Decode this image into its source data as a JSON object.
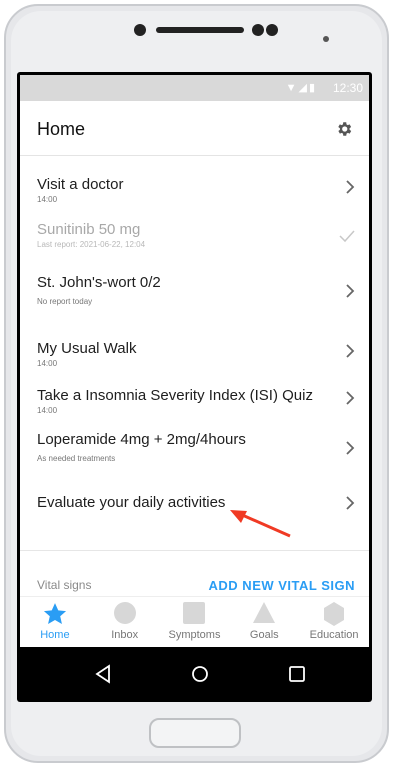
{
  "status": {
    "time": "12:30"
  },
  "header": {
    "title": "Home"
  },
  "items": [
    {
      "title": "Visit a doctor",
      "sub": "14:00"
    },
    {
      "title": "Sunitinib 50 mg",
      "sub": "Last report: 2021-06-22, 12:04"
    },
    {
      "title": "St. John's-wort 0/2",
      "sub": "No report today"
    },
    {
      "title": "My Usual Walk",
      "sub": "14:00"
    },
    {
      "title": "Take a Insomnia Severity Index (ISI) Quiz",
      "sub": "14:00"
    },
    {
      "title": "Loperamide 4mg + 2mg/4hours",
      "sub": "As needed treatments"
    },
    {
      "title": "Evaluate your daily activities",
      "sub": ""
    }
  ],
  "vital": {
    "title": "Vital signs",
    "add_label": "ADD NEW VITAL SIGN"
  },
  "tabs": [
    {
      "label": "Home",
      "icon": "star-icon"
    },
    {
      "label": "Inbox",
      "icon": "circle-icon"
    },
    {
      "label": "Symptoms",
      "icon": "square-icon"
    },
    {
      "label": "Goals",
      "icon": "triangle-icon"
    },
    {
      "label": "Education",
      "icon": "hexagon-icon"
    }
  ],
  "colors": {
    "accent": "#2a9df4",
    "annotation": "#f03a24"
  }
}
